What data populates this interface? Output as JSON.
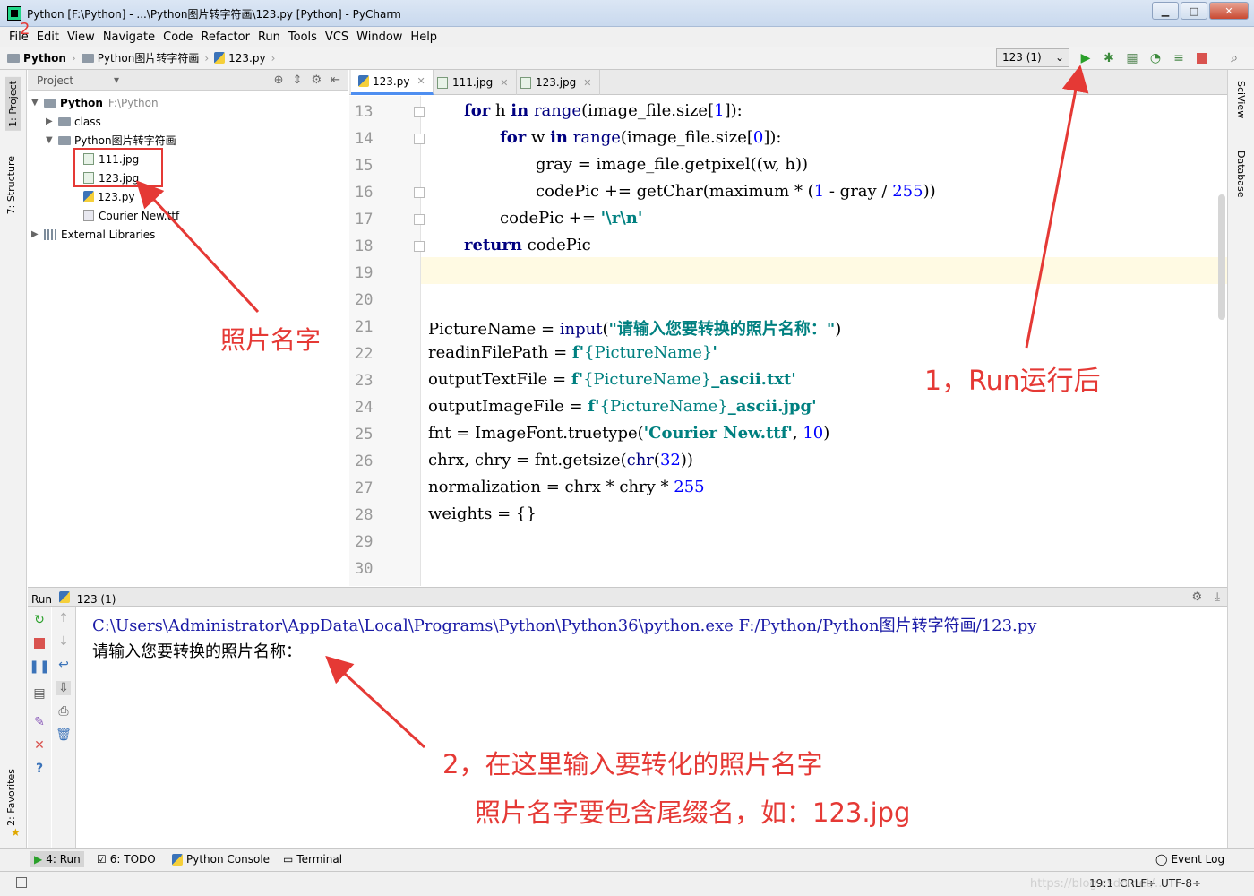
{
  "window": {
    "title": "Python [F:\\Python] - ...\\Python图片转字符画\\123.py [Python] - PyCharm",
    "minimize": "▁",
    "maximize": "□",
    "close": "✕"
  },
  "menu": [
    "File",
    "Edit",
    "View",
    "Navigate",
    "Code",
    "Refactor",
    "Run",
    "Tools",
    "VCS",
    "Window",
    "Help"
  ],
  "breadcrumb": {
    "project": "Python",
    "folder": "Python图片转字符画",
    "file": "123.py"
  },
  "run_config": {
    "label": "123 (1)"
  },
  "side_tabs": {
    "project": "1: Project",
    "structure": "7: Structure",
    "favorites": "2: Favorites",
    "sciview": "SciView",
    "database": "Database"
  },
  "project_panel": {
    "title": "Project",
    "root_name": "Python",
    "root_path": "F:\\Python",
    "items": {
      "class": "class",
      "folder": "Python图片转字符画",
      "file1": "111.jpg",
      "file2": "123.jpg",
      "file3": "123.py",
      "file4": "Courier New.ttf",
      "libs": "External Libraries"
    }
  },
  "editor_tabs": [
    "123.py",
    "111.jpg",
    "123.jpg"
  ],
  "line_numbers": [
    "13",
    "14",
    "15",
    "16",
    "17",
    "18",
    "19",
    "20",
    "21",
    "22",
    "23",
    "24",
    "25",
    "26",
    "27",
    "28",
    "29",
    "30"
  ],
  "code": {
    "l13_kw": "for",
    "l13_a": " h ",
    "l13_kw2": "in",
    "l13_b": " ",
    "l13_bi": "range",
    "l13_c": "(image_file.size[",
    "l13_n": "1",
    "l13_d": "]):",
    "l14_kw": "for",
    "l14_a": " w ",
    "l14_kw2": "in",
    "l14_b": " ",
    "l14_bi": "range",
    "l14_c": "(image_file.size[",
    "l14_n": "0",
    "l14_d": "]):",
    "l15": "gray = image_file.getpixel((w, h))",
    "l16_a": "codePic += getChar(maximum * (",
    "l16_n1": "1",
    "l16_b": " - gray / ",
    "l16_n2": "255",
    "l16_c": "))",
    "l17_a": "codePic += ",
    "l17_s": "'\\r\\n'",
    "l18_kw": "return",
    "l18_a": " codePic",
    "l21_a": "PictureName = ",
    "l21_bi": "input",
    "l21_b": "(",
    "l21_s": "\"请输入您要转换的照片名称：\"",
    "l21_c": ")",
    "l22_a": "readinFilePath = ",
    "l22_s1": "f'",
    "l22_b": "{PictureName}",
    "l22_s2": "'",
    "l23_a": "outputTextFile = ",
    "l23_s1": "f'",
    "l23_b": "{PictureName}",
    "l23_s2": "_ascii.txt'",
    "l24_a": "outputImageFile = ",
    "l24_s1": "f'",
    "l24_b": "{PictureName}",
    "l24_s2": "_ascii.jpg'",
    "l25_a": "fnt = ImageFont.truetype(",
    "l25_s": "'Courier New.ttf'",
    "l25_b": ", ",
    "l25_n": "10",
    "l25_c": ")",
    "l26_a": "chrx, chry = fnt.getsize(",
    "l26_bi": "chr",
    "l26_b": "(",
    "l26_n": "32",
    "l26_c": "))",
    "l27_a": "normalization = chrx * chry * ",
    "l27_n": "255",
    "l28": "weights = {}"
  },
  "run_panel": {
    "label": "Run",
    "config": "123 (1)",
    "command": "C:\\Users\\Administrator\\AppData\\Local\\Programs\\Python\\Python36\\python.exe F:/Python/Python图片转字符画/123.py",
    "prompt": "请输入您要转换的照片名称："
  },
  "bottom_tabs": {
    "run": "4: Run",
    "todo": "6: TODO",
    "console": "Python Console",
    "terminal": "Terminal",
    "event_log": "Event Log"
  },
  "status": {
    "position": "19:1",
    "line_sep": "CRLF÷",
    "encoding": "UTF-8÷",
    "watermark": "https://blog.csdn.net/..."
  },
  "annotations": {
    "photo_name": "照片名字",
    "step1": "1，Run运行后",
    "step2": "2，在这里输入要转化的照片名字",
    "step2_note": "照片名字要包含尾缀名，如：123.jpg",
    "step2_mark": "2",
    "color": "#e53935"
  }
}
